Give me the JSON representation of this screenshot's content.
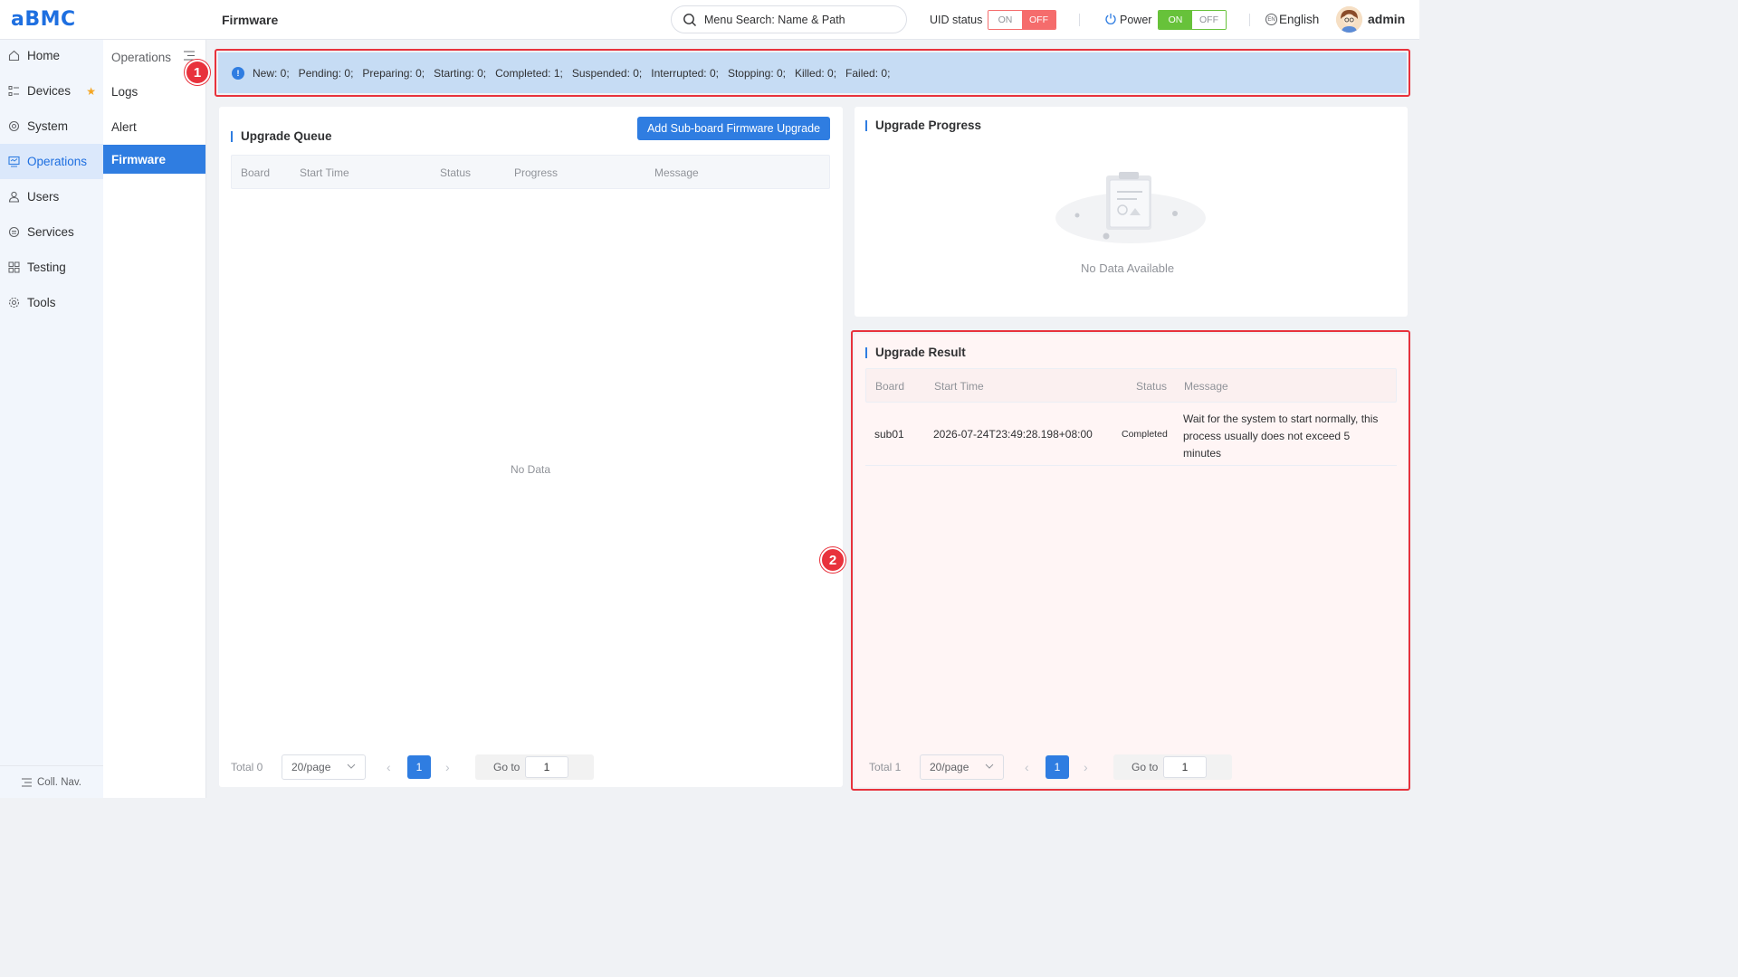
{
  "app": {
    "logo": "aBMC",
    "page_title": "Firmware"
  },
  "header": {
    "search_placeholder": "Menu Search: Name & Path",
    "uid_label": "UID status",
    "uid_on": "ON",
    "uid_off": "OFF",
    "power_label": "Power",
    "power_on": "ON",
    "power_off": "OFF",
    "language": "English",
    "globe_text": "EN",
    "user": "admin"
  },
  "sidebar": {
    "items": [
      {
        "label": "Home",
        "icon": "home-icon"
      },
      {
        "label": "Devices",
        "icon": "devices-icon"
      },
      {
        "label": "System",
        "icon": "system-icon"
      },
      {
        "label": "Operations",
        "icon": "operations-icon"
      },
      {
        "label": "Users",
        "icon": "users-icon"
      },
      {
        "label": "Services",
        "icon": "services-icon"
      },
      {
        "label": "Testing",
        "icon": "testing-icon"
      },
      {
        "label": "Tools",
        "icon": "tools-icon"
      }
    ],
    "collapse_label": "Coll. Nav."
  },
  "subnav": {
    "header": "Operations",
    "items": [
      "Logs",
      "Alert",
      "Firmware"
    ]
  },
  "banner": {
    "text": "New: 0;   Pending: 0;   Preparing: 0;   Starting: 0;   Completed: 1;   Suspended: 0;   Interrupted: 0;   Stopping: 0;   Killed: 0;   Failed: 0;",
    "marker": "1"
  },
  "queue": {
    "title": "Upgrade Queue",
    "add_button": "Add Sub-board Firmware Upgrade",
    "columns": [
      "Board",
      "Start Time",
      "Status",
      "Progress",
      "Message"
    ],
    "empty_text": "No Data",
    "pager": {
      "total": "Total 0",
      "size": "20/page",
      "page": "1",
      "goto_label": "Go to",
      "goto_value": "1"
    }
  },
  "progress": {
    "title": "Upgrade Progress",
    "empty_text": "No Data Available"
  },
  "result": {
    "title": "Upgrade Result",
    "marker": "2",
    "columns": [
      "Board",
      "Start Time",
      "Status",
      "Message"
    ],
    "rows": [
      {
        "board": "sub01",
        "start_time": "2026-07-24T23:49:28.198+08:00",
        "status": "Completed",
        "message_lines": [
          "Wait for the system to start normally, this",
          "process usually does not exceed 5",
          "minutes"
        ]
      }
    ],
    "pager": {
      "total": "Total 1",
      "size": "20/page",
      "page": "1",
      "goto_label": "Go to",
      "goto_value": "1"
    }
  },
  "colors": {
    "accent": "#2f7de1",
    "danger": "#e8323c",
    "success": "#67c23a",
    "banner_bg": "#c6dcf4"
  }
}
